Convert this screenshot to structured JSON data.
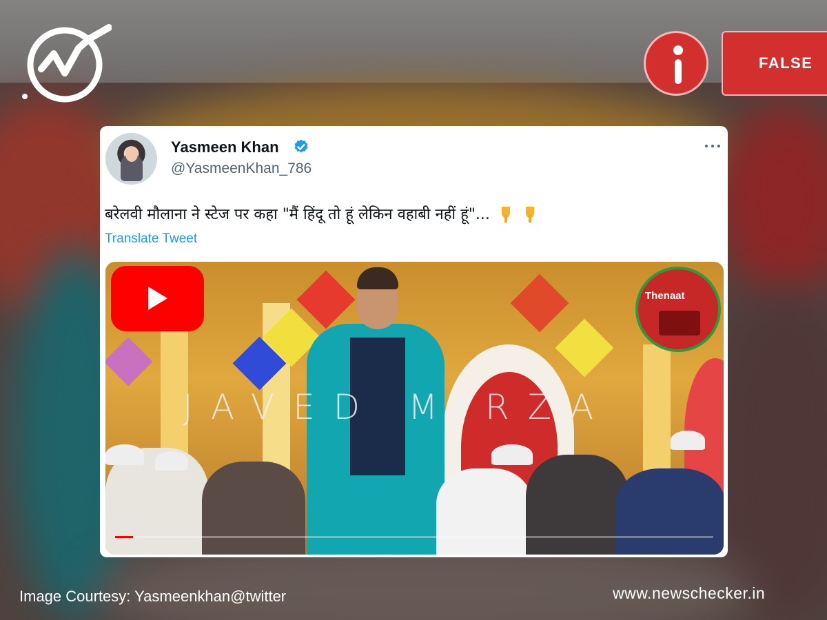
{
  "badge": {
    "verdict": "FALSE",
    "color": "#d32f2f"
  },
  "tweet": {
    "author_name": "Yasmeen Khan",
    "author_handle": "@YasmeenKhan_786",
    "verified": true,
    "text": "बरेलवी मौलाना ने स्टेज पर कहा \"मैं हिंदू तो हूं लेकिन वहाबी नहीं हूं\"...",
    "translate_label": "Translate Tweet",
    "more_icon": "more-options-icon",
    "emoji_icons": [
      "pointing-down-icon",
      "pointing-down-icon"
    ]
  },
  "video": {
    "watermark": "JAVED MIRZA",
    "channel_label": "Thenaat",
    "play_icon": "youtube-play-icon",
    "progress": 0.03
  },
  "footer": {
    "courtesy": "Image Courtesy: Yasmeenkhan@twitter",
    "site": "www.newschecker.in"
  }
}
